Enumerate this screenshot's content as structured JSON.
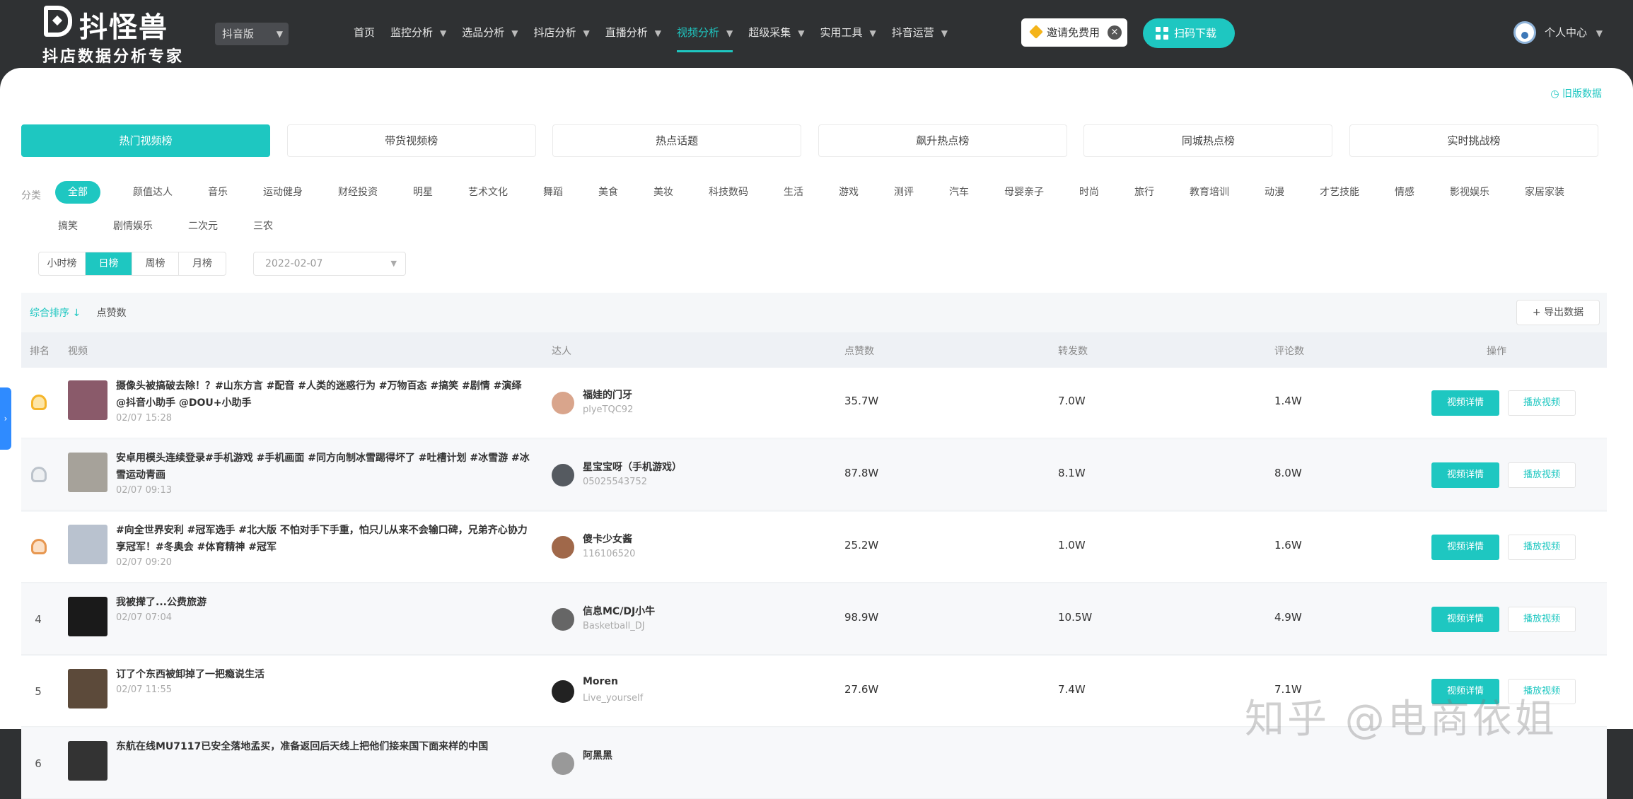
{
  "header": {
    "logo_name": "抖怪兽",
    "logo_sub": "抖店数据分析专家",
    "platform_label": "抖音版",
    "nav": [
      {
        "label": "首页",
        "arrow": false,
        "active": false
      },
      {
        "label": "监控分析",
        "arrow": true,
        "active": false
      },
      {
        "label": "选品分析",
        "arrow": true,
        "active": false
      },
      {
        "label": "抖店分析",
        "arrow": true,
        "active": false
      },
      {
        "label": "直播分析",
        "arrow": true,
        "active": false
      },
      {
        "label": "视频分析",
        "arrow": true,
        "active": true
      },
      {
        "label": "超级采集",
        "arrow": true,
        "active": false
      },
      {
        "label": "实用工具",
        "arrow": true,
        "active": false
      },
      {
        "label": "抖音运营",
        "arrow": true,
        "active": false
      }
    ],
    "invite_label": "邀请免费用",
    "app_label": "扫码下载",
    "user_label": "个人中心"
  },
  "old_version_label": "◷ 旧版数据",
  "tabs": [
    {
      "label": "热门视频榜",
      "active": true
    },
    {
      "label": "带货视频榜",
      "active": false
    },
    {
      "label": "热点话题",
      "active": false
    },
    {
      "label": "飙升热点榜",
      "active": false
    },
    {
      "label": "同城热点榜",
      "active": false
    },
    {
      "label": "实时挑战榜",
      "active": false
    }
  ],
  "category_label": "分类",
  "categories": [
    {
      "label": "全部",
      "active": true
    },
    {
      "label": "颜值达人",
      "active": false
    },
    {
      "label": "音乐",
      "active": false
    },
    {
      "label": "运动健身",
      "active": false
    },
    {
      "label": "财经投资",
      "active": false
    },
    {
      "label": "明星",
      "active": false
    },
    {
      "label": "艺术文化",
      "active": false
    },
    {
      "label": "舞蹈",
      "active": false
    },
    {
      "label": "美食",
      "active": false
    },
    {
      "label": "美妆",
      "active": false
    },
    {
      "label": "科技数码",
      "active": false
    },
    {
      "label": "生活",
      "active": false
    },
    {
      "label": "游戏",
      "active": false
    },
    {
      "label": "测评",
      "active": false
    },
    {
      "label": "汽车",
      "active": false
    },
    {
      "label": "母婴亲子",
      "active": false
    },
    {
      "label": "时尚",
      "active": false
    },
    {
      "label": "旅行",
      "active": false
    },
    {
      "label": "教育培训",
      "active": false
    },
    {
      "label": "动漫",
      "active": false
    },
    {
      "label": "才艺技能",
      "active": false
    },
    {
      "label": "情感",
      "active": false
    },
    {
      "label": "影视娱乐",
      "active": false
    },
    {
      "label": "家居家装",
      "active": false
    },
    {
      "label": "搞笑",
      "active": false
    },
    {
      "label": "剧情娱乐",
      "active": false
    },
    {
      "label": "二次元",
      "active": false
    },
    {
      "label": "三农",
      "active": false
    }
  ],
  "periods": [
    {
      "label": "小时榜",
      "active": false
    },
    {
      "label": "日榜",
      "active": true
    },
    {
      "label": "周榜",
      "active": false
    },
    {
      "label": "月榜",
      "active": false
    }
  ],
  "date_value": "2022-02-07",
  "sort": {
    "primary": "综合排序 ↓",
    "secondary": "点赞数"
  },
  "export_label": "+ 导出数据",
  "columns": {
    "rank": "排名",
    "video": "视频",
    "kol": "达人",
    "likes": "点赞数",
    "shares": "转发数",
    "comments": "评论数",
    "action": "操作"
  },
  "rows": [
    {
      "rank": "1",
      "medal": "gold",
      "title": "摄像头被搞破去除！？#山东方言 #配音 #人类的迷惑行为 #万物百态 #搞笑 #剧情 #演绎 @抖音小助手 @DOU+小助手",
      "date": "02/07 15:28",
      "kol_name": "福娃的门牙",
      "kol_id": "plyeTQC92",
      "likes": "35.7W",
      "shares": "7.0W",
      "comments": "1.4W",
      "thumb_color": "#8a5a6a",
      "avatar_color": "#d9a58c"
    },
    {
      "rank": "2",
      "medal": "silver",
      "title": "安卓用模头连续登录#手机游戏 #手机画面 #同方向制冰雪踢得坏了 #吐槽计划 #冰雪游 #冰雪运动青画",
      "date": "02/07 09:13",
      "kol_name": "星宝宝呀（手机游戏）",
      "kol_id": "05025543752",
      "likes": "87.8W",
      "shares": "8.1W",
      "comments": "8.0W",
      "thumb_color": "#a6a29a",
      "avatar_color": "#555a60"
    },
    {
      "rank": "3",
      "medal": "bronze",
      "title": "#向全世界安利 #冠军选手 #北大版 不怕对手下手重，怕只儿从来不会输口碑，兄弟齐心协力享冠军！#冬奥会 #体育精神 #冠军",
      "date": "02/07 09:20",
      "kol_name": "傻卡少女酱",
      "kol_id": "116106520",
      "likes": "25.2W",
      "shares": "1.0W",
      "comments": "1.6W",
      "thumb_color": "#b9c2cf",
      "avatar_color": "#a0684a"
    },
    {
      "rank": "4",
      "medal": "",
      "title": "我被撵了...公费旅游",
      "date": "02/07 07:04",
      "kol_name": "信息MC/DJ小牛",
      "kol_id": "Basketball_DJ",
      "likes": "98.9W",
      "shares": "10.5W",
      "comments": "4.9W",
      "thumb_color": "#1a1a1a",
      "avatar_color": "#666"
    },
    {
      "rank": "5",
      "medal": "",
      "title": "订了个东西被卸掉了一把瘾说生活",
      "date": "02/07 11:55",
      "kol_name": "Moren",
      "kol_id": "Live_yourself",
      "likes": "27.6W",
      "shares": "7.4W",
      "comments": "7.1W",
      "thumb_color": "#5c4a3a",
      "avatar_color": "#222"
    },
    {
      "rank": "6",
      "medal": "",
      "title": "东航在线MU7117已安全落地孟买，准备返回后天线上把他们接来国下面来样的中国",
      "date": "",
      "kol_name": "阿黑黑",
      "kol_id": "",
      "likes": "",
      "shares": "",
      "comments": "",
      "thumb_color": "#333",
      "avatar_color": "#999"
    }
  ],
  "row_buttons": {
    "detail": "视频详情",
    "play": "播放视频"
  },
  "watermark": "知乎 @电商依姐",
  "accent_color": "#1ec7c1"
}
